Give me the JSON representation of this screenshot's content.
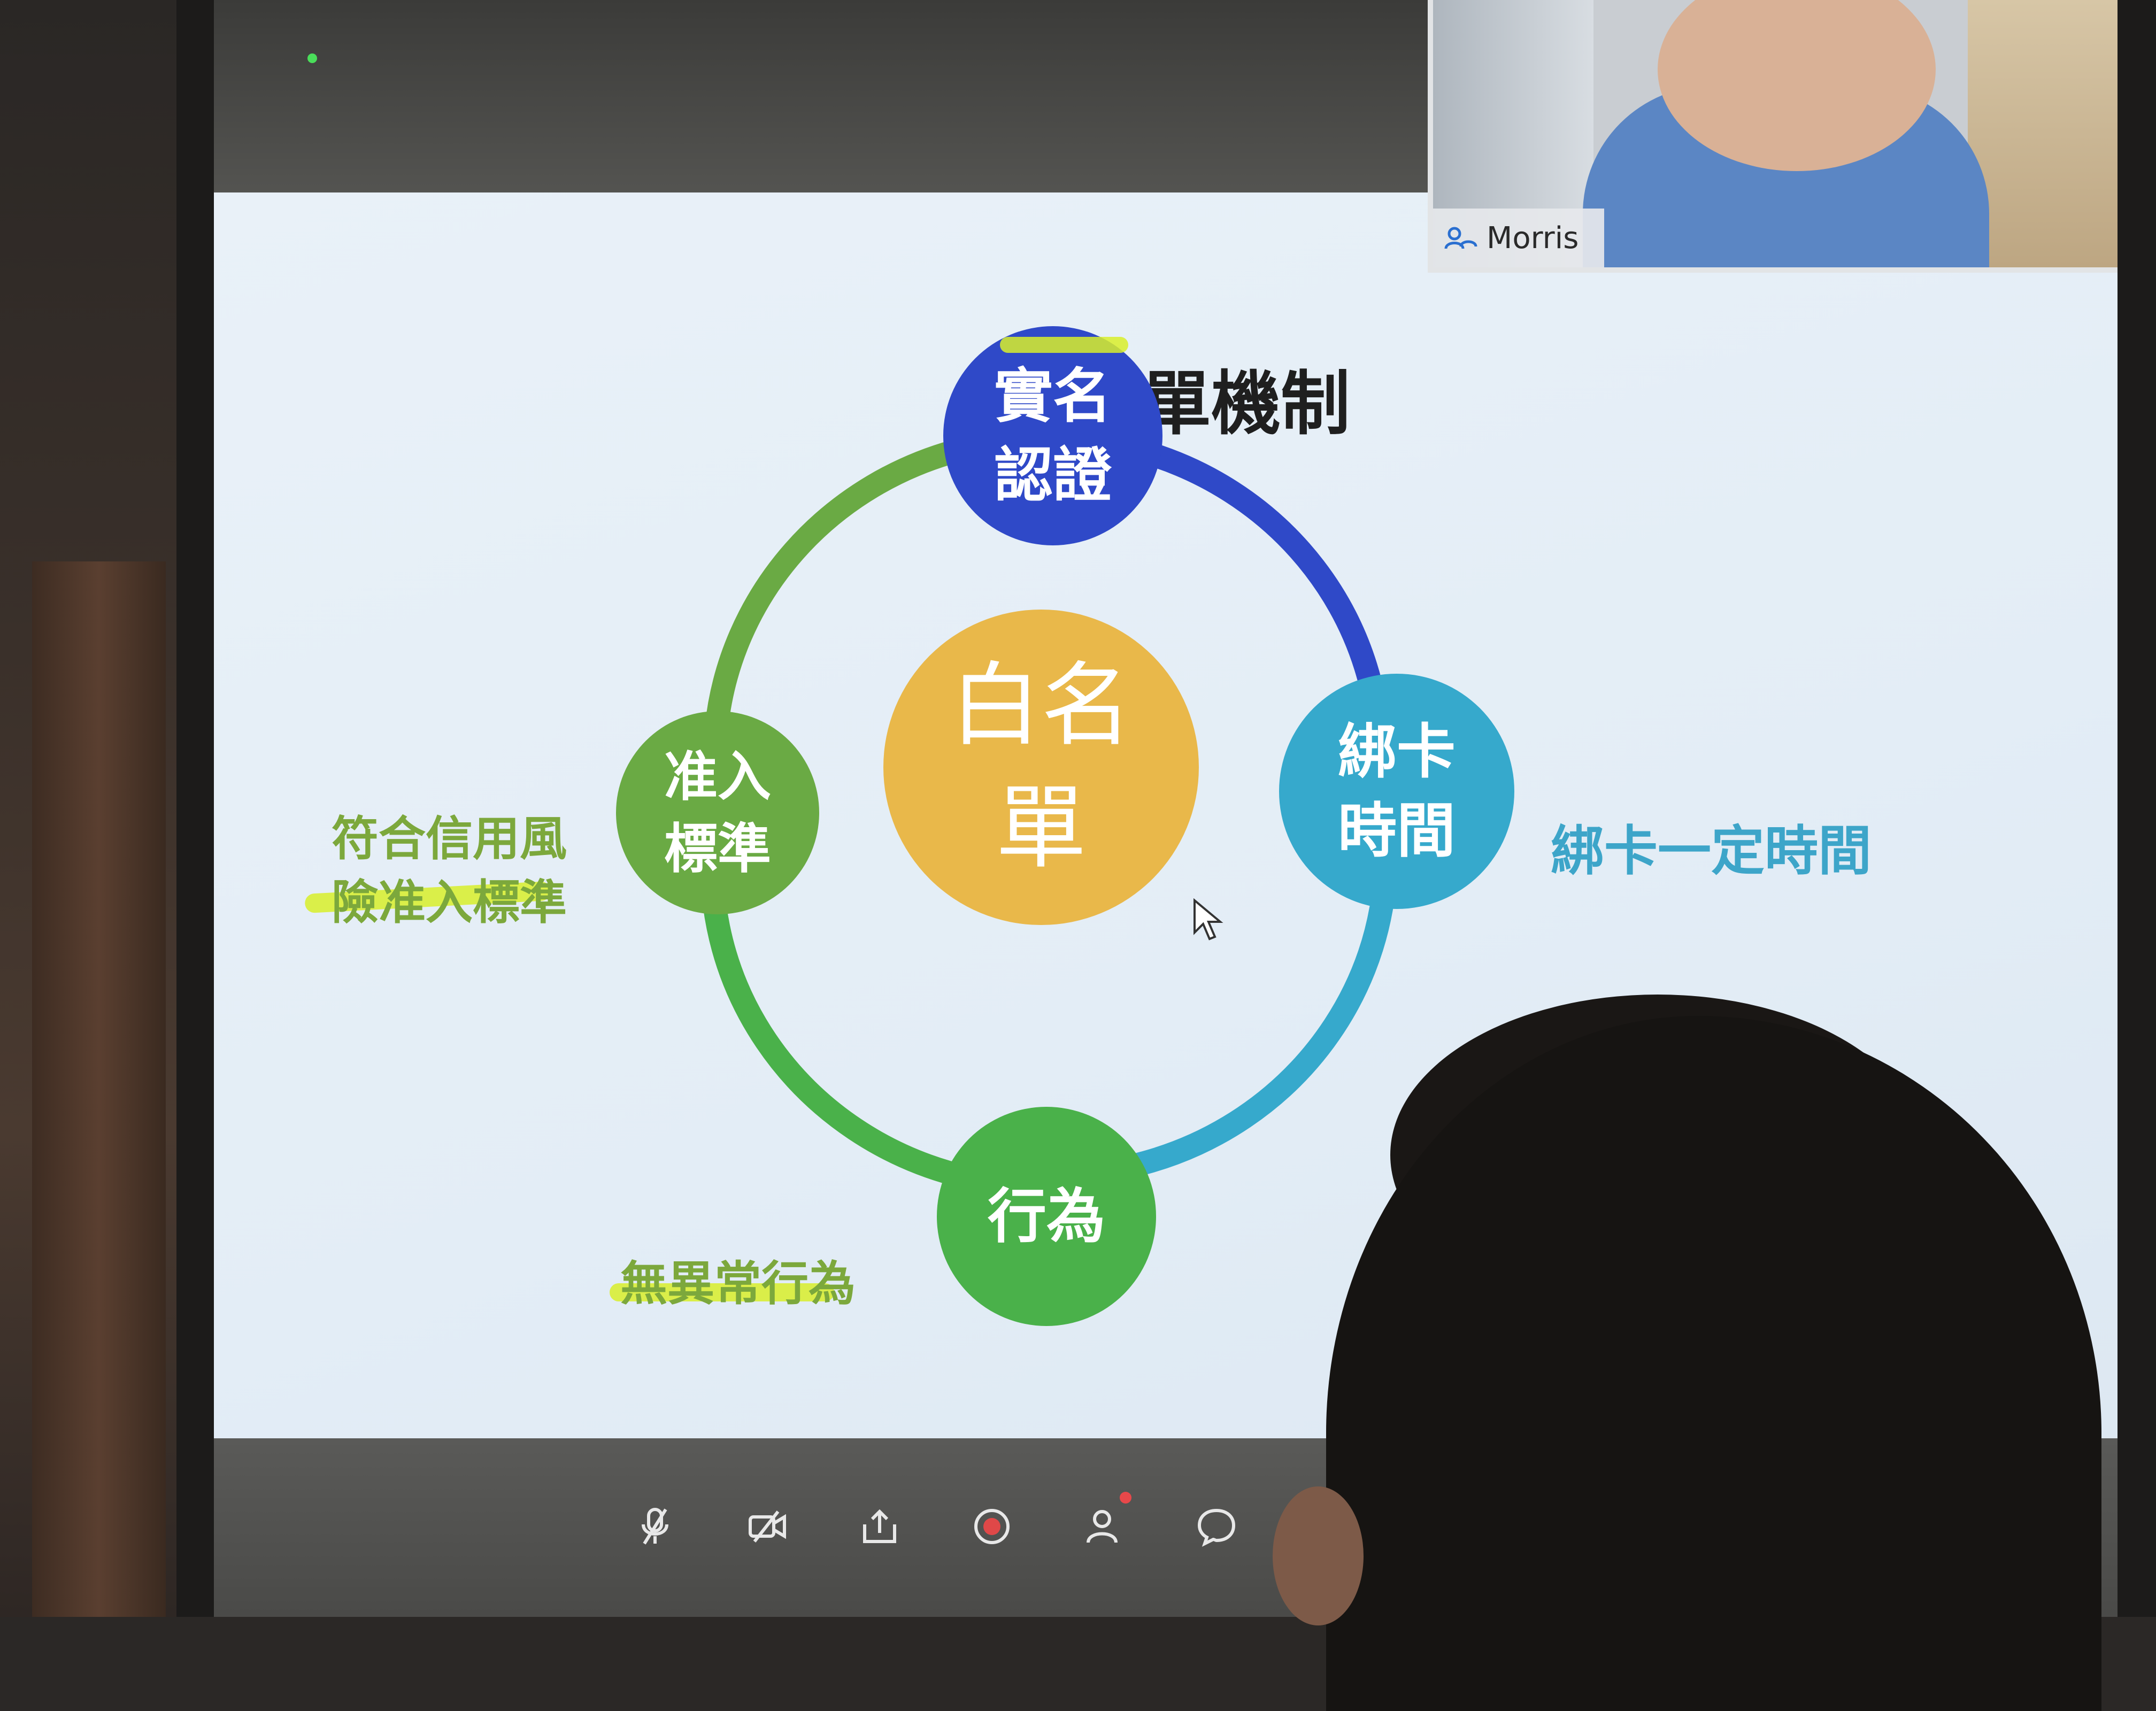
{
  "slide": {
    "title": "白名單機制",
    "center_node": {
      "line1": "白名",
      "line2": "單",
      "color": "#e9b84a"
    },
    "nodes": [
      {
        "id": "shiming",
        "line1": "實名",
        "line2": "認證",
        "color": "#2f49c8"
      },
      {
        "id": "bind",
        "line1": "綁卡",
        "line2": "時間",
        "color": "#36a9cc"
      },
      {
        "id": "behavior",
        "line1": "行為",
        "color": "#4ab14a"
      },
      {
        "id": "admit",
        "line1": "准入",
        "line2": "標準",
        "color": "#6aaa44"
      }
    ],
    "notes": {
      "admit_line1": "符合信用風",
      "admit_line2": "險准入標準",
      "bind": "綁卡一定時間",
      "behavior": "無異常行為"
    },
    "ring_colors": [
      "#2f49c8",
      "#36a9cc",
      "#4ab14a",
      "#6aaa44"
    ],
    "highlight_color": "#d8ef2a"
  },
  "video": {
    "participant_name": "Morris",
    "icon": "cloud-user-icon"
  },
  "toolbar": {
    "buttons": [
      {
        "name": "mute-button",
        "icon": "microphone-muted-icon"
      },
      {
        "name": "video-button",
        "icon": "video-camera-off-icon"
      },
      {
        "name": "share-button",
        "icon": "share-upload-icon"
      },
      {
        "name": "record-button",
        "icon": "record-icon"
      },
      {
        "name": "participants-button",
        "icon": "participants-icon"
      },
      {
        "name": "chat-button",
        "icon": "chat-bubble-icon"
      }
    ]
  }
}
